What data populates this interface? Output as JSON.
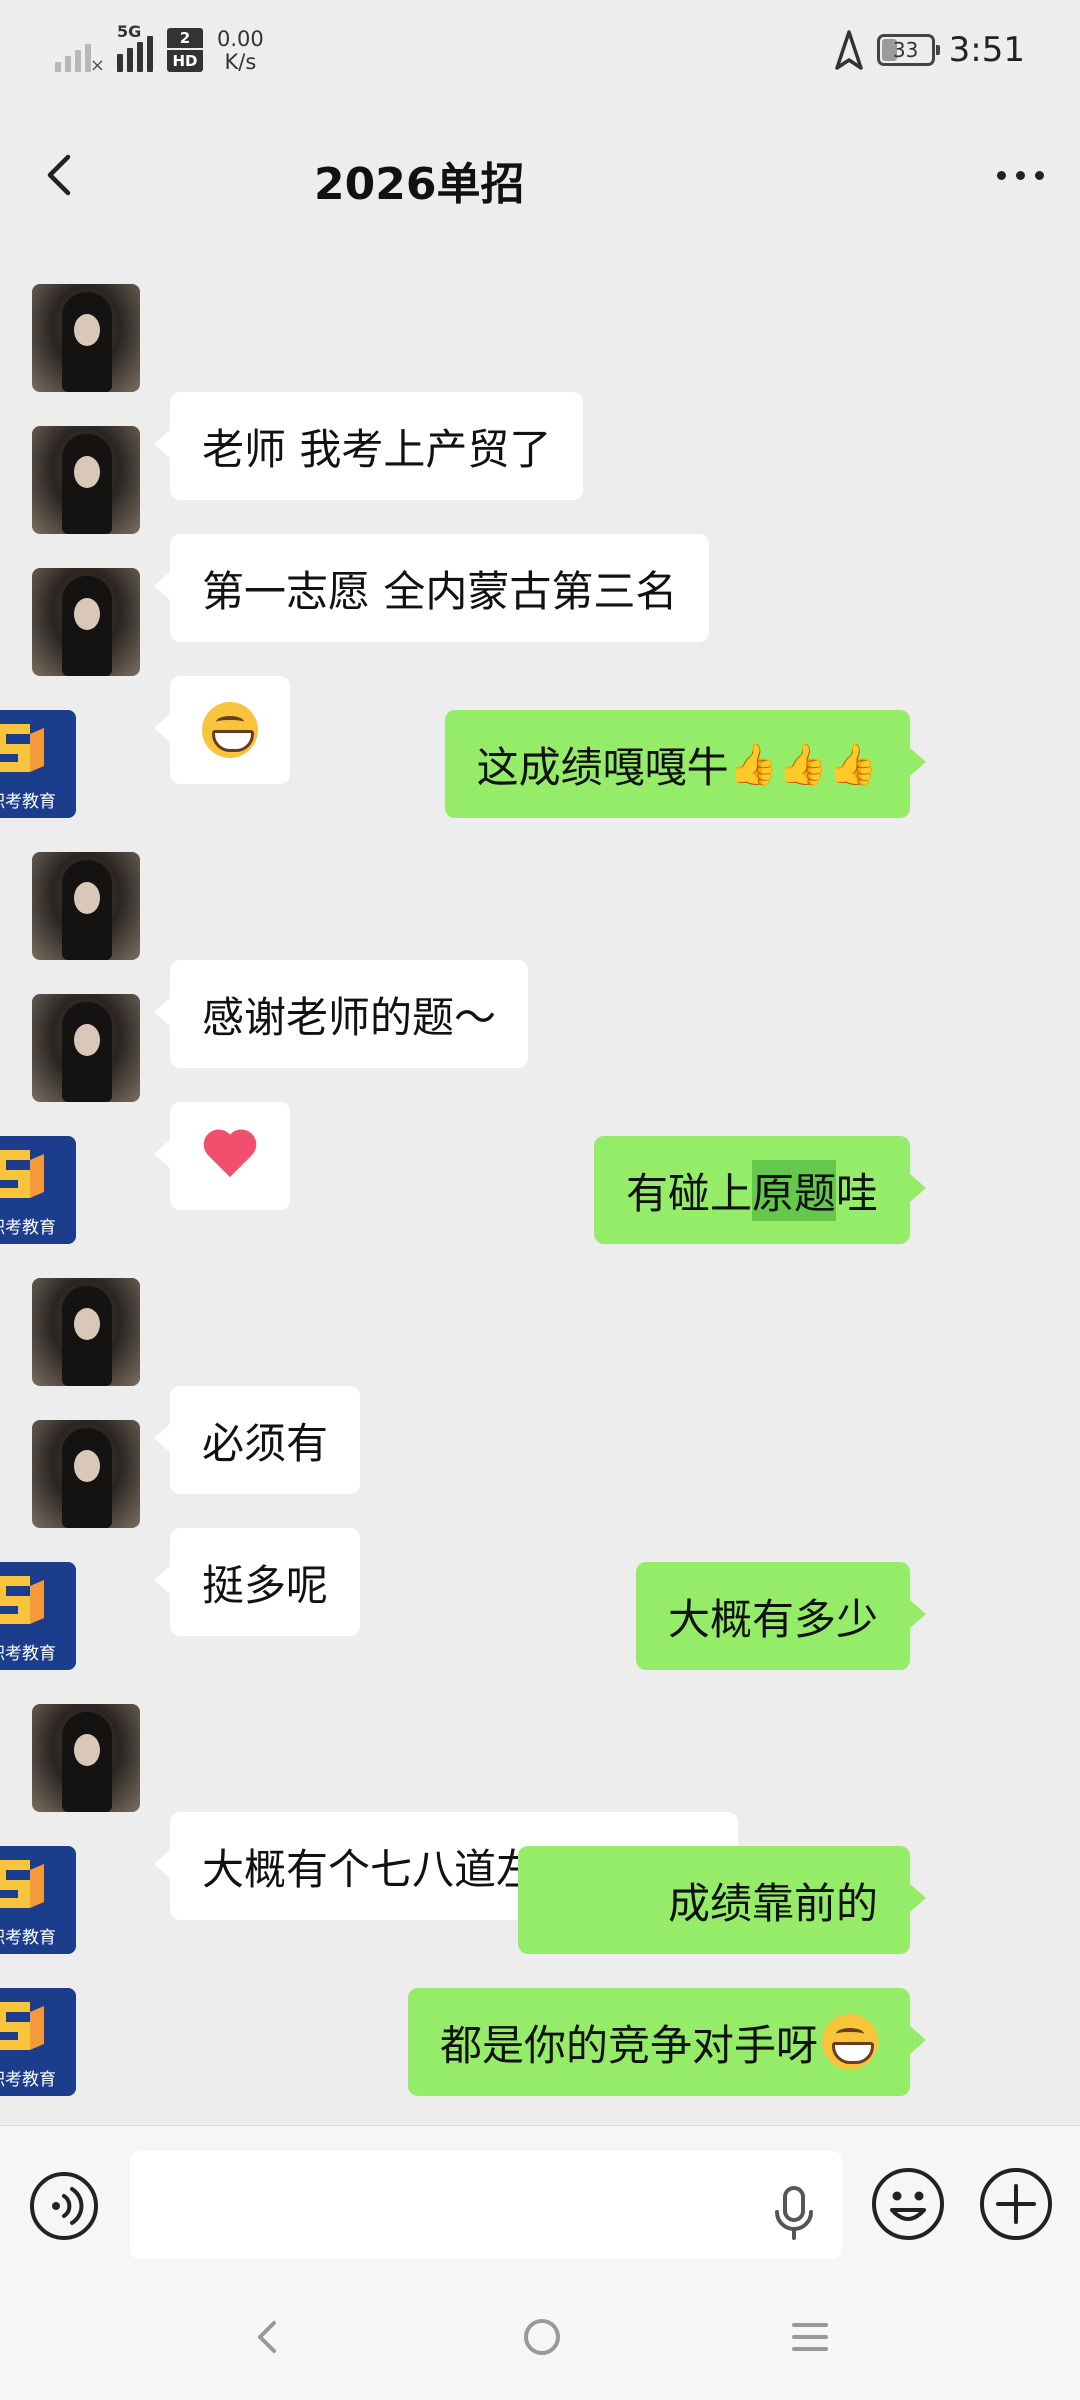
{
  "status_bar": {
    "network_tag": "5G",
    "sim2_number": "2",
    "sim2_tag": "HD",
    "speed_value": "0.00",
    "speed_unit": "K/s",
    "battery": "33",
    "time": "3:51"
  },
  "header": {
    "title": "2026单招",
    "back_icon": "chevron-left-icon",
    "more_icon": "more-dots-icon"
  },
  "messages": [
    {
      "side": "left",
      "text": "老师 我考上产贸了"
    },
    {
      "side": "left",
      "text": "第一志愿 全内蒙古第三名"
    },
    {
      "side": "left",
      "emoji": "grinning-face"
    },
    {
      "side": "right",
      "text": "这成绩嘎嘎牛",
      "trailing": "👍👍👍"
    },
    {
      "side": "left",
      "text": "感谢老师的题～"
    },
    {
      "side": "left",
      "emoji": "heart"
    },
    {
      "side": "right",
      "text_a": "有碰上",
      "text_highlight": "原题",
      "text_b": "哇"
    },
    {
      "side": "left",
      "text": "必须有"
    },
    {
      "side": "left",
      "text": "挺多呢"
    },
    {
      "side": "right",
      "text": "大概有多少"
    },
    {
      "side": "left",
      "text": "大概有个七八道左右专业课"
    },
    {
      "side": "right",
      "text": "成绩靠前的"
    },
    {
      "side": "right",
      "text": "都是你的竞争对手呀",
      "emoji": "grinning-face"
    }
  ],
  "logo_caption": "职考教育",
  "input_bar": {
    "placeholder": "",
    "icons": [
      "voice-icon",
      "mic-icon",
      "emoji-icon",
      "plus-icon"
    ]
  },
  "nav_bar": {
    "icons": [
      "nav-back-icon",
      "nav-home-icon",
      "nav-menu-icon"
    ]
  },
  "colors": {
    "background": "#ededed",
    "bubble_self": "#95ec69",
    "bubble_other": "#ffffff",
    "logo_blue": "#1b3d8c",
    "logo_orange": "#f39a3a"
  }
}
